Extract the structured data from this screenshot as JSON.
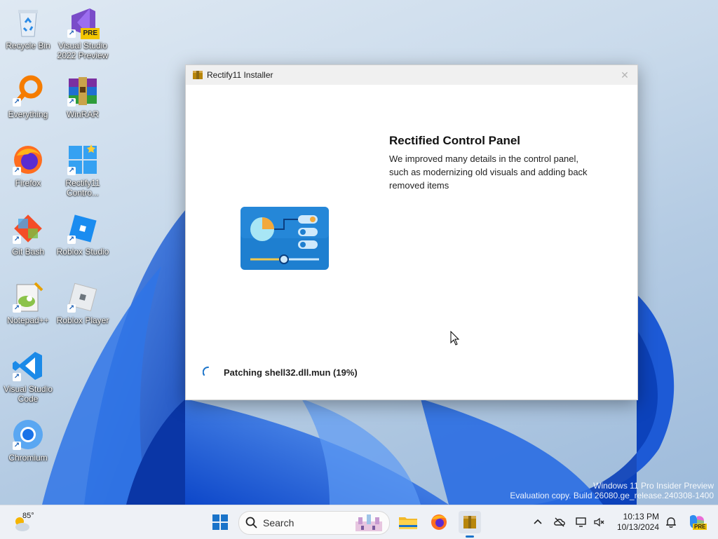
{
  "desktop": {
    "icons": [
      {
        "label": "Recycle Bin"
      },
      {
        "label": "Visual Studio 2022 Preview",
        "badge": "PRE"
      },
      {
        "label": "Everything"
      },
      {
        "label": "WinRAR"
      },
      {
        "label": "Firefox"
      },
      {
        "label": "Rectify11 Contro..."
      },
      {
        "label": "Git Bash"
      },
      {
        "label": "Roblox Studio"
      },
      {
        "label": "Notepad++"
      },
      {
        "label": "Roblox Player"
      },
      {
        "label": "Visual Studio Code"
      },
      {
        "label": "Chromium"
      }
    ]
  },
  "installer": {
    "title": "Rectify11 Installer",
    "close_glyph": "✕",
    "feature_title": "Rectified Control Panel",
    "feature_description": "We improved many details in the control panel, such as modernizing old visuals and adding back removed items",
    "status_text": "Patching shell32.dll.mun (19%)"
  },
  "watermark": {
    "line1": "Windows 11 Pro Insider Preview",
    "line2": "Evaluation copy. Build 26080.ge_release.240308-1400"
  },
  "taskbar": {
    "weather_temp": "85°",
    "search_label": "Search",
    "clock_time": "10:13 PM",
    "clock_date": "10/13/2024",
    "copilot_badge": "PRE"
  },
  "colors": {
    "accent": "#1a73c9",
    "wallpaper_blue": "#1f5fd6",
    "control_panel_tile": "#1e7fd0"
  }
}
